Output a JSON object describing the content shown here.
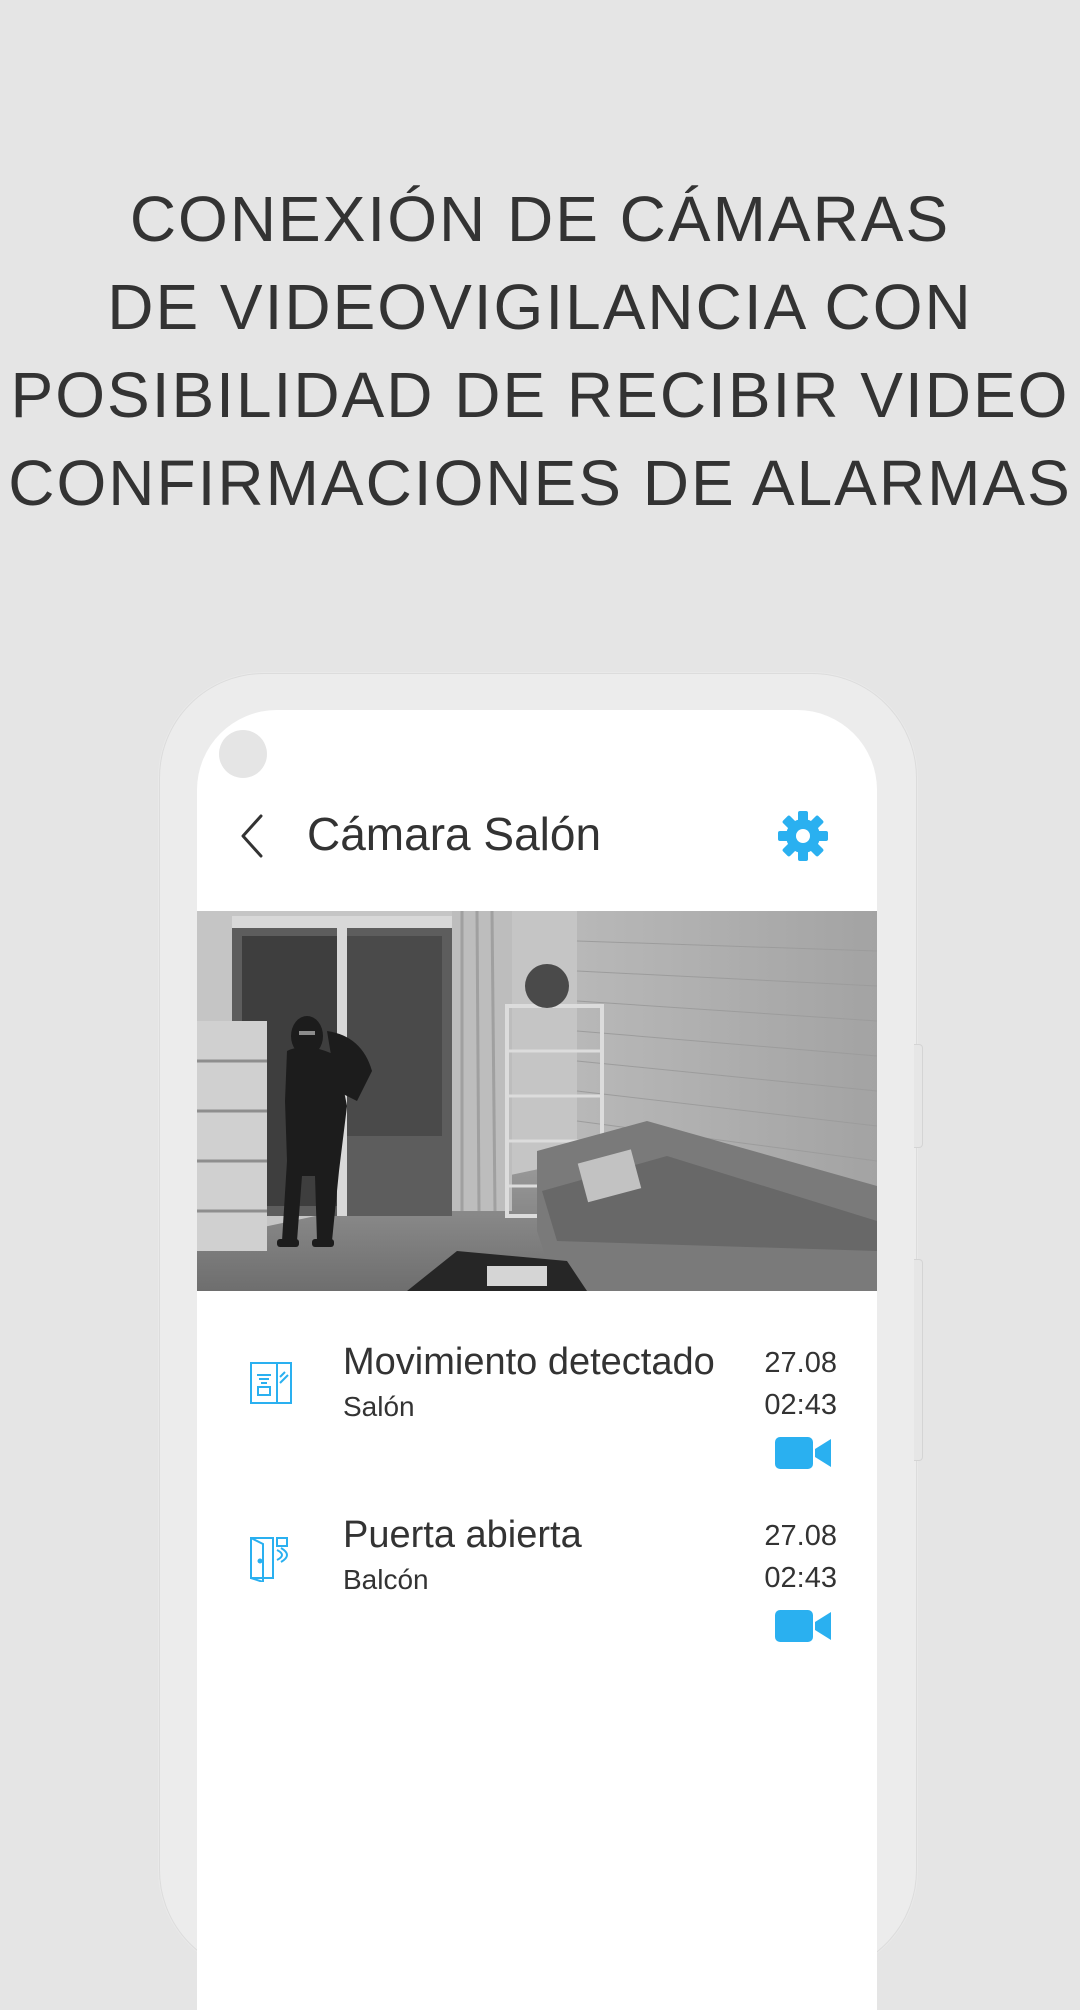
{
  "headline": {
    "lines": [
      "CONEXIÓN DE CÁMARAS",
      "DE VIDEOVIGILANCIA CON",
      "POSIBILIDAD DE RECIBIR VIDEO",
      "CONFIRMACIONES DE ALARMAS"
    ]
  },
  "app": {
    "title": "Cámara Salón",
    "icons": {
      "back": "chevron-left-icon",
      "settings": "gear-icon",
      "video": "video-camera-icon"
    },
    "accent_color": "#2ab0f0"
  },
  "events": [
    {
      "title": "Movimiento detectado",
      "location": "Salón",
      "date": "27.08",
      "time": "02:43",
      "icon": "motion-sensor-icon"
    },
    {
      "title": "Puerta abierta",
      "location": "Balcón",
      "date": "27.08",
      "time": "02:43",
      "icon": "door-sensor-icon"
    }
  ]
}
